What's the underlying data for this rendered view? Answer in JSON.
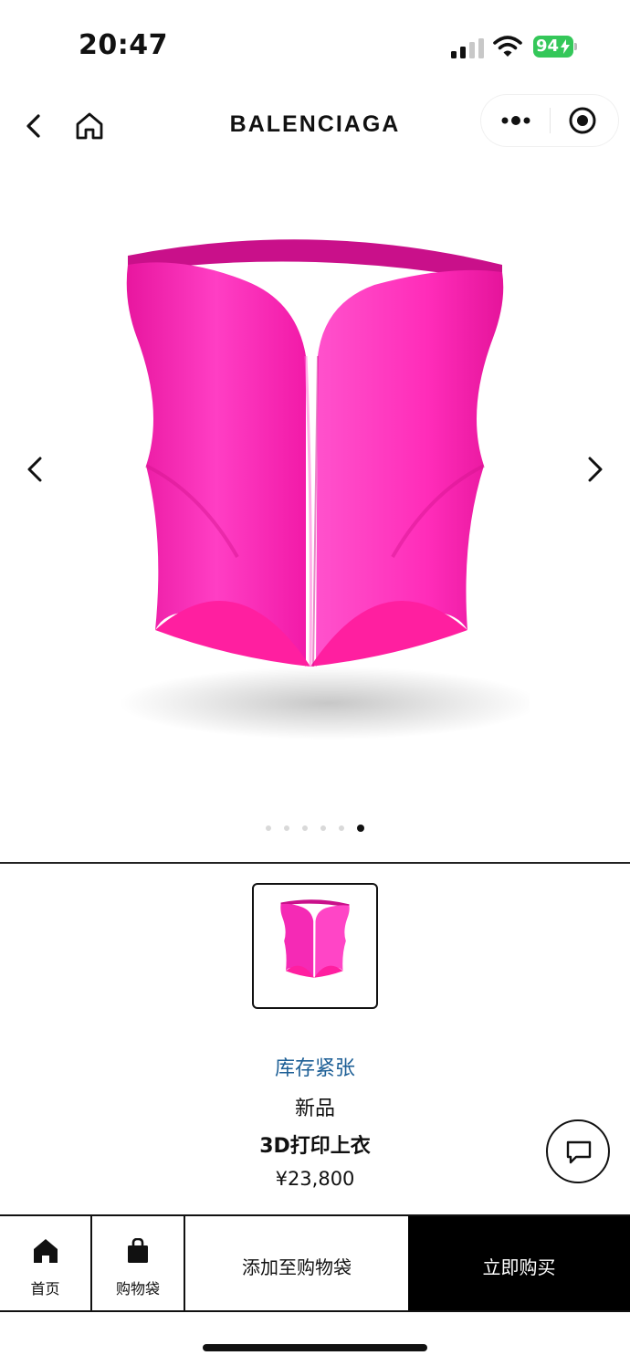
{
  "status_bar": {
    "time": "20:47",
    "battery_percent": "94",
    "icons": [
      "signal-icon",
      "wifi-icon",
      "battery-icon"
    ]
  },
  "header": {
    "brand": "BALENCIAGA",
    "icons": [
      "back-icon",
      "home-icon",
      "more-icon",
      "target-icon"
    ]
  },
  "gallery": {
    "image": "pink-3d-printed-top-image",
    "slide_count": 6,
    "active_slide": 6,
    "icons": [
      "chevron-left-icon",
      "chevron-right-icon"
    ]
  },
  "product": {
    "stock_status": "库存紧张",
    "tag": "新品",
    "name": "3D打印上衣",
    "price": "¥23,800"
  },
  "bottom_bar": {
    "home_label": "首页",
    "bag_label": "购物袋",
    "add_to_bag_label": "添加至购物袋",
    "buy_now_label": "立即购买"
  },
  "colors": {
    "product_pink": "#ff1fb0",
    "stock_blue": "#1d5f96",
    "battery_green": "#34c759"
  }
}
